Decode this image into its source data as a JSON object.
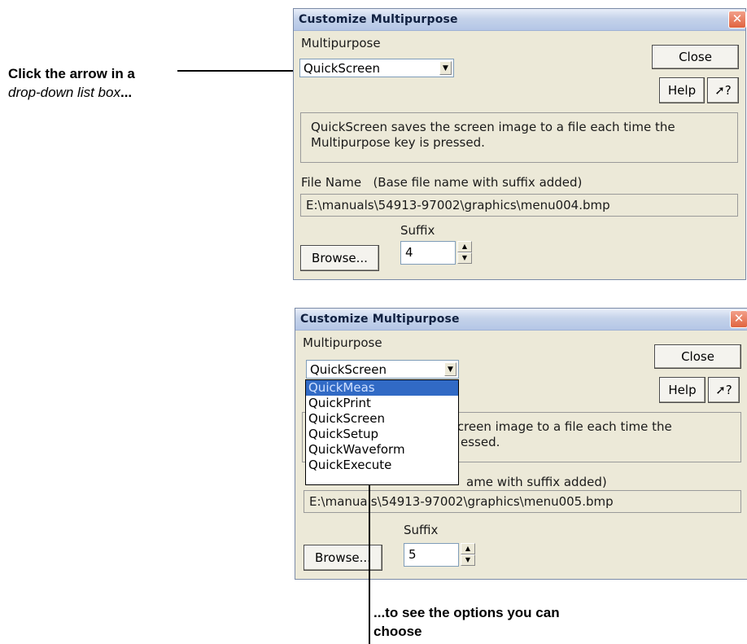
{
  "annotation_top": {
    "line1": "Click the arrow in a",
    "line2_italic": "drop-down list box",
    "line2_suffix": "..."
  },
  "annotation_bottom": {
    "line1": "...to see the options you can",
    "line2": "choose"
  },
  "dialog1": {
    "title": "Customize Multipurpose",
    "close_x": "✕",
    "multipurpose_label": "Multipurpose",
    "multipurpose_value": "QuickScreen",
    "close_button": "Close",
    "help_button": "Help",
    "whats_this_button": "?",
    "description": "QuickScreen saves the screen image to a file each time the Multipurpose key is pressed.",
    "file_name_label": "File Name",
    "file_name_hint": "(Base file name with suffix added)",
    "file_path": "E:\\manuals\\54913-97002\\graphics\\menu004.bmp",
    "suffix_label": "Suffix",
    "suffix_value": "4",
    "browse_button": "Browse..."
  },
  "dialog2": {
    "title": "Customize Multipurpose",
    "close_x": "✕",
    "multipurpose_label": "Multipurpose",
    "multipurpose_value": "QuickScreen",
    "close_button": "Close",
    "help_button": "Help",
    "whats_this_button": "?",
    "description_line1_visible": "screen image to a file each time the",
    "description_line2_visible": "essed.",
    "file_name_label_visible": "ame with suffix added)",
    "file_path": "E:\\manuals\\54913-97002\\graphics\\menu005.bmp",
    "suffix_label": "Suffix",
    "suffix_value": "5",
    "browse_button": "Browse...",
    "dropdown_options": [
      "QuickMeas",
      "QuickPrint",
      "QuickScreen",
      "QuickSetup",
      "QuickWaveform",
      "QuickExecute"
    ],
    "dropdown_highlighted": "QuickMeas"
  }
}
